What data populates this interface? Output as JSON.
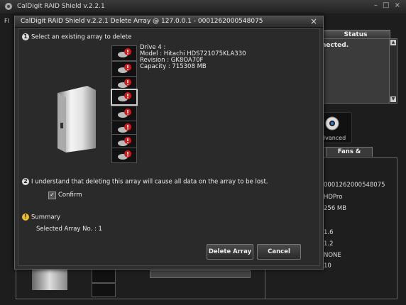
{
  "main": {
    "title": "CalDigit RAID Shield v.2.2.1",
    "win_controls": "– □ ×",
    "status_header": "Status",
    "status_text": "nected.",
    "advanced_label": "dvanced",
    "tab_fans_power": "Fans & Power",
    "info_values": [
      "0001262000548075",
      "HDPro",
      "256 MB",
      "1.6",
      "1.2",
      "NONE",
      "10"
    ]
  },
  "dialog": {
    "title_prefix": "Fl",
    "title": "CalDigit RAID Shield v.2.2.1 Delete Array @ 127.0.0.1 - 0001262000548075",
    "close": "×",
    "step1": {
      "num": "1",
      "label": "Select an existing array to delete"
    },
    "drive_info": {
      "line1": "Drive 4 :",
      "line2": "Model : Hitachi HDS721075KLA330",
      "line3": "Revision : GK8OA70F",
      "line4": "Capacity : 715308 MB"
    },
    "step2": {
      "num": "2",
      "label": "I understand that deleting this array will cause all data on the array to be lost."
    },
    "confirm": {
      "label": "Confirm",
      "checked": true,
      "mark": "✓"
    },
    "summary": {
      "icon": "!",
      "label": "Summary",
      "selected": "Selected Array No. : 1"
    },
    "buttons": {
      "delete": "Delete Array",
      "cancel": "Cancel"
    }
  },
  "colors": {
    "drive_red": "#d81818",
    "drive_green": "#2ca02c",
    "warn": "#f0c020"
  }
}
